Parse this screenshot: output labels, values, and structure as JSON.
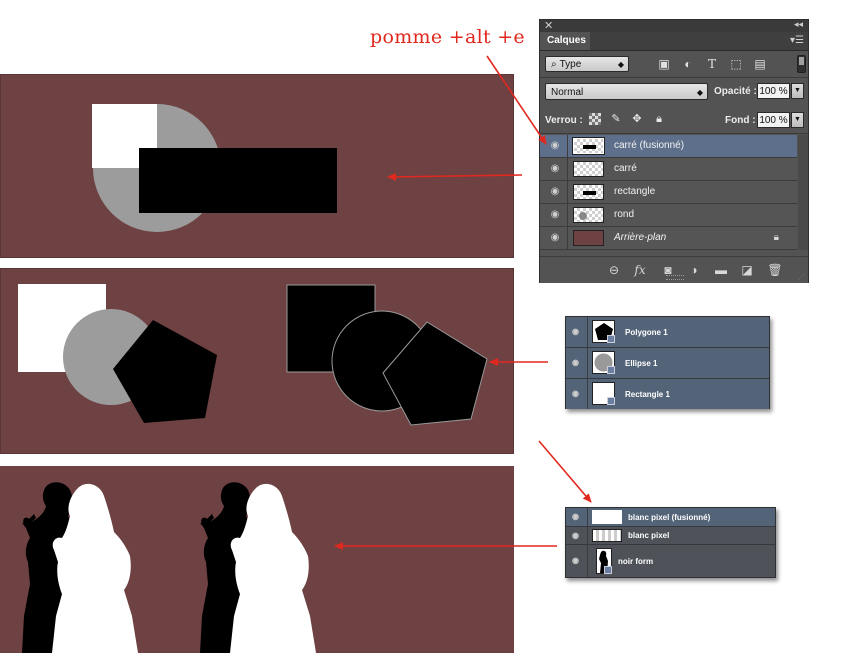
{
  "annotation": {
    "text": "pomme +alt +e"
  },
  "canvas_color": "#6e4142",
  "arrow_color": "#e0281e",
  "panel": {
    "close_icon": "close-icon",
    "collapse_icon": "double-chevron-icon",
    "tab_label": "Calques",
    "menu_icon": "panel-menu-icon",
    "filter_kind": "Type",
    "filter_icons": [
      "image-filter-icon",
      "adjustment-filter-icon",
      "text-filter-icon",
      "shape-filter-icon",
      "smart-object-filter-icon"
    ],
    "blend_mode": "Normal",
    "opacity_label": "Opacité :",
    "opacity_value": "100 %",
    "lock_label": "Verrou :",
    "fill_label": "Fond :",
    "fill_value": "100 %",
    "layers": [
      {
        "name": "carré (fusionné)",
        "selected": true,
        "thumb": "bar"
      },
      {
        "name": "carré",
        "selected": false,
        "thumb": "empty"
      },
      {
        "name": "rectangle",
        "selected": false,
        "thumb": "bar"
      },
      {
        "name": "rond",
        "selected": false,
        "thumb": "blob"
      },
      {
        "name": "Arrière-plan",
        "selected": false,
        "thumb": "background",
        "italic": true,
        "locked": true
      }
    ],
    "bottom_icons": [
      "link-icon",
      "fx-icon",
      "mask-icon",
      "adjustment-icon",
      "folder-icon",
      "new-layer-icon",
      "trash-icon"
    ],
    "fx_label": "fx"
  },
  "mini_panel_shapes": {
    "layers": [
      {
        "name": "Polygone 1"
      },
      {
        "name": "Ellipse 1"
      },
      {
        "name": "Rectangle 1"
      }
    ]
  },
  "mini_panel_pixels": {
    "layers": [
      {
        "name": "blanc pixel (fusionné)",
        "selected": true
      },
      {
        "name": "blanc pixel",
        "selected": false
      },
      {
        "name": "noir form",
        "selected": false
      }
    ]
  }
}
